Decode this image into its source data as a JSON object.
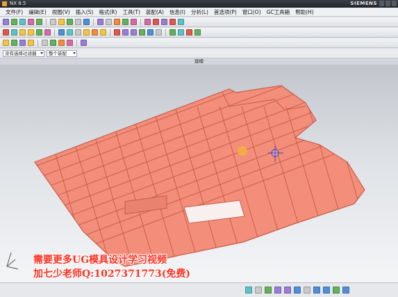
{
  "window": {
    "title": "NX 8.5",
    "brand": "SIEMENS"
  },
  "menu": {
    "items": [
      "文件(F)",
      "编辑(E)",
      "视图(V)",
      "插入(S)",
      "格式(R)",
      "工具(T)",
      "装配(A)",
      "信息(I)",
      "分析(L)",
      "首选项(P)",
      "窗口(O)",
      "GC工具箱",
      "帮助(H)"
    ]
  },
  "selection_bar": {
    "filter_value": "没有选择过滤器",
    "scope_value": "整个装配"
  },
  "viewport": {
    "title": "建模",
    "part_color": "#f28e7a",
    "part_edge_color": "#c85a48",
    "highlight_marker_color": "#f6b040"
  },
  "watermark": {
    "line1": "需要更多UG模具设计学习视频",
    "line2": "加七少老师Q:1027371773(免费)",
    "color": "#ff3020"
  },
  "icons": {
    "toolbar1": [
      "new-file-icon",
      "open-icon",
      "save-icon",
      "cut-icon",
      "copy-icon",
      "paste-icon",
      "undo-icon",
      "redo-icon",
      "start-icon",
      "command-finder-icon",
      "layer-icon",
      "shade-icon",
      "wireframe-icon",
      "zoom-icon",
      "rotate-icon",
      "pan-icon",
      "fit-icon",
      "view-orient-icon",
      "render-icon",
      "section-icon"
    ],
    "toolbar2": [
      "sketch-icon",
      "extrude-icon",
      "revolve-icon",
      "hole-icon",
      "boss-icon",
      "pocket-icon",
      "blend-icon",
      "chamfer-icon",
      "shell-icon",
      "trim-icon",
      "mirror-icon",
      "pattern-icon",
      "offset-icon",
      "draft-icon",
      "mold-wizard-icon",
      "parting-icon",
      "core-cavity-icon",
      "slide-icon",
      "ejector-icon",
      "cooling-icon",
      "electrode-icon",
      "measure-icon"
    ],
    "toolbar3": [
      "snap-endpoint-icon",
      "snap-midpoint-icon",
      "snap-center-icon",
      "snap-quadrant-icon",
      "snap-intersection-icon",
      "snap-point-icon",
      "snap-face-icon",
      "snap-edge-icon",
      "snap-vertex-icon"
    ],
    "bottom": [
      "view-front-icon",
      "view-top-icon",
      "view-right-icon",
      "view-iso-icon",
      "view-trimetric-icon",
      "fit-view-icon",
      "zoom-window-icon",
      "rotate-view-icon",
      "pan-view-icon",
      "refresh-icon",
      "perspective-icon"
    ]
  }
}
